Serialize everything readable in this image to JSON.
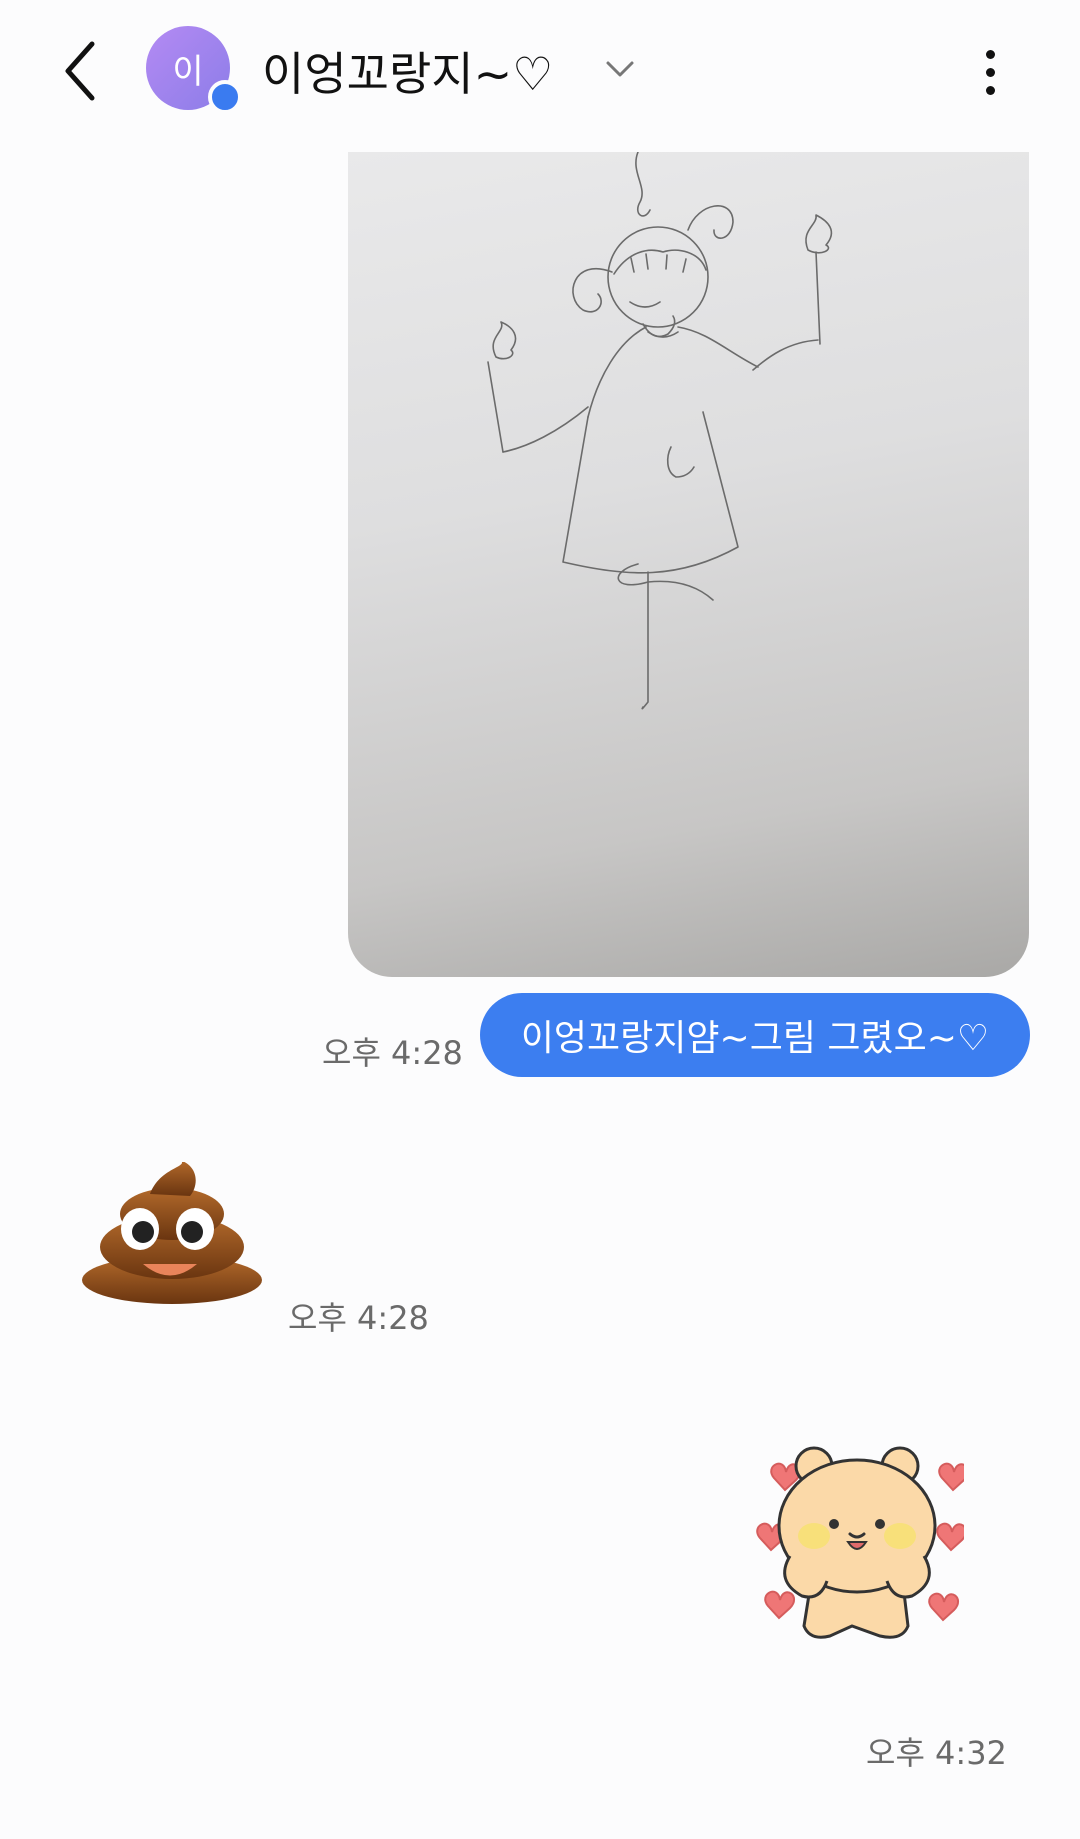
{
  "header": {
    "back_icon": "chevron-left-icon",
    "avatar_initial": "이",
    "contact_name": "이엉꼬랑지~♡",
    "dropdown_icon": "chevron-down-icon",
    "more_icon": "more-vertical-icon"
  },
  "messages": [
    {
      "type": "image",
      "direction": "outgoing",
      "description_icon": "photo-drawing"
    },
    {
      "type": "text",
      "direction": "outgoing",
      "text": "이엉꼬랑지얌~그림 그렸오~♡",
      "time": "오후 4:28"
    },
    {
      "type": "emoji",
      "direction": "incoming",
      "icon": "poop-emoji",
      "time": "오후 4:28"
    },
    {
      "type": "sticker",
      "direction": "outgoing",
      "icon": "bear-sticker",
      "time": "오후 4:32"
    }
  ],
  "colors": {
    "accent": "#3c7ef0",
    "avatar": "#a884f0",
    "time": "#6a6a6a"
  }
}
